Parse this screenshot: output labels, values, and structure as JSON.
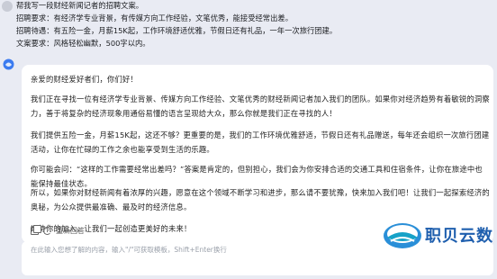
{
  "prompt": {
    "line1": "帮我写一段财经新闻记者的招聘文案。",
    "line2": "招聘要求：有经济学专业背景，有传媒方向工作经验，文笔优秀，能接受经常出差。",
    "line3": "招聘待遇：有五险一金，月薪15K起，工作环境舒适优雅，节假日还有礼品，一年一次旅行团建。",
    "line4": "文案要求：风格轻松幽默，500字以内。"
  },
  "response": {
    "p1": "亲爱的财经爱好者们，你们好！",
    "p2": "我们正在寻找一位有经济学专业背景、传媒方向工作经验、文笔优秀的财经新闻记者加入我们的团队。如果你对经济趋势有着敏锐的洞察力，善于将复杂的经济现象用通俗易懂的语言呈现给大众，那么你就是我们正在寻找的人！",
    "p3": "我们提供五险一金，月薪15K起，这还不够？更重要的是，我们的工作环境优雅舒适，节假日还有礼品赠送，每年还会组织一次旅行团建活动，让你在忙碌的工作之余也能享受到生活的乐趣。",
    "p4": "你可能会问：“这样的工作需要经常出差吗？”答案是肯定的，但别担心，我们会为你安排合适的交通工具和住宿条件，让你在旅途中也能保持最佳状态。",
    "p5": "所以，如果你对财经新闻有着浓厚的兴趣，愿意在这个领域不断学习和进步，那么请不要犹豫，快来加入我们吧！让我们一起探索经济的奥秘，为公众提供最准确、最及时的经济信息。",
    "p6": "期待你的加入，让我们一起创造更美好的未来！"
  },
  "actions": {
    "rewrite_label": "重新回答"
  },
  "input": {
    "placeholder": "在此输入您想了解的内容，输入\"/\"可获取模板，Shift+Enter换行"
  },
  "logo": {
    "text": "职贝云数"
  },
  "colors": {
    "background": "#e9ebf3",
    "card": "#ffffff",
    "logo_blue": "#1f5fae"
  }
}
